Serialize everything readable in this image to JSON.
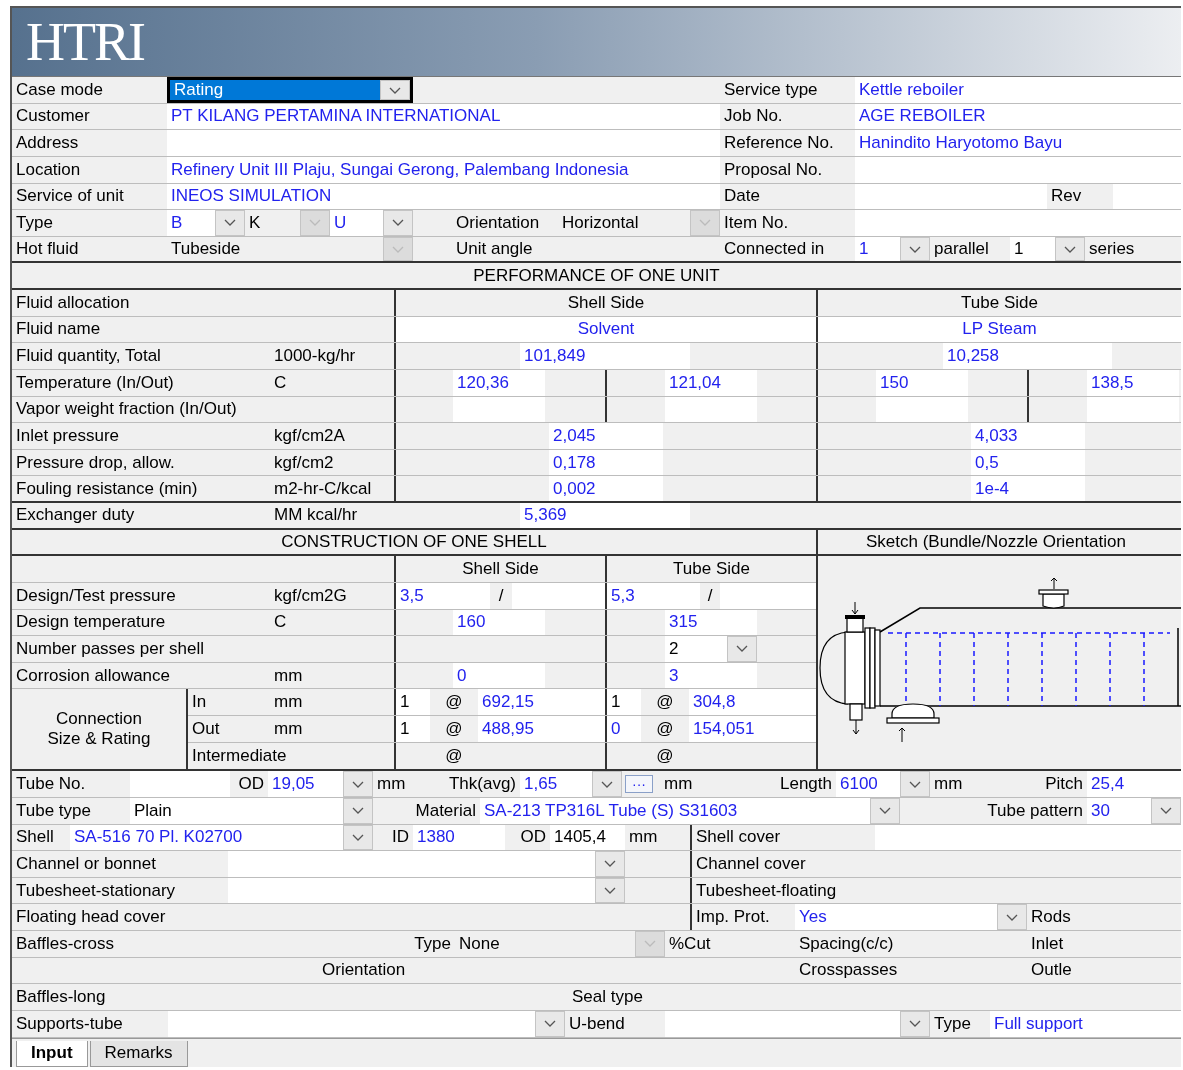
{
  "logo": "HTRI",
  "general": {
    "lines": [
      {
        "fields": [
          {
            "kind": "label",
            "text": "Case mode"
          },
          {
            "kind": "combo",
            "text": "Rating",
            "focused": true
          },
          {
            "kind": "label",
            "text": "Service type"
          },
          {
            "kind": "value",
            "text": "Kettle reboiler"
          }
        ]
      },
      {
        "fields": [
          {
            "kind": "label",
            "text": "Customer"
          },
          {
            "kind": "value",
            "text": "PT KILANG PERTAMINA INTERNATIONAL"
          },
          {
            "kind": "label",
            "text": "Job No."
          },
          {
            "kind": "value",
            "text": "AGE REBOILER"
          }
        ]
      },
      {
        "fields": [
          {
            "kind": "label",
            "text": "Address"
          },
          {
            "kind": "field"
          },
          {
            "kind": "label",
            "text": "Reference No."
          },
          {
            "kind": "value",
            "text": "Hanindito Haryotomo Bayu"
          }
        ]
      },
      {
        "fields": [
          {
            "kind": "label",
            "text": "Location"
          },
          {
            "kind": "value",
            "text": "Refinery Unit III Plaju, Sungai Gerong, Palembang Indonesia"
          },
          {
            "kind": "label",
            "text": "Proposal No."
          },
          {
            "kind": "field"
          }
        ]
      },
      {
        "fields": [
          {
            "kind": "label",
            "text": "Service of unit"
          },
          {
            "kind": "value",
            "text": "INEOS SIMULATION"
          },
          {
            "kind": "label",
            "text": "Date"
          },
          {
            "kind": "field"
          },
          {
            "kind": "label",
            "text": "Rev"
          },
          {
            "kind": "field"
          }
        ]
      },
      {
        "fields": [
          {
            "kind": "label",
            "text": "Type"
          },
          {
            "kind": "combo",
            "text": "B"
          },
          {
            "kind": "combo",
            "text": "K",
            "disabled": true
          },
          {
            "kind": "combo",
            "text": "U"
          },
          {
            "kind": "label",
            "text": "Orientation"
          },
          {
            "kind": "combo",
            "text": "Horizontal",
            "disabled": true
          },
          {
            "kind": "label",
            "text": "Item No."
          },
          {
            "kind": "field"
          }
        ]
      },
      {
        "fields": [
          {
            "kind": "label",
            "text": "Hot fluid"
          },
          {
            "kind": "combo",
            "text": "Tubeside",
            "disabled": true
          },
          {
            "kind": "label",
            "text": "Unit angle"
          },
          {
            "kind": "label",
            "text": "Connected in"
          },
          {
            "kind": "combo",
            "text": "1"
          },
          {
            "kind": "label",
            "text": "parallel"
          },
          {
            "kind": "combo",
            "text": "1",
            "default": true
          },
          {
            "kind": "label",
            "text": "series"
          }
        ]
      }
    ]
  },
  "performance": {
    "title": "PERFORMANCE OF ONE UNIT",
    "lines": [
      {
        "fields": [
          {
            "kind": "label",
            "text": "Fluid allocation"
          },
          {
            "kind": "heading",
            "text": "Shell Side"
          },
          {
            "kind": "heading",
            "text": "Tube Side"
          }
        ]
      },
      {
        "fields": [
          {
            "kind": "label",
            "text": "Fluid name"
          },
          {
            "kind": "value",
            "text": "Solvent"
          },
          {
            "kind": "value",
            "text": "LP Steam"
          }
        ]
      },
      {
        "fields": [
          {
            "kind": "label",
            "text": "Fluid quantity, Total"
          },
          {
            "kind": "label",
            "text": "1000-kg/hr"
          },
          {
            "kind": "value",
            "text": "101,849"
          },
          {
            "kind": "value",
            "text": "10,258"
          }
        ]
      },
      {
        "fields": [
          {
            "kind": "label",
            "text": "Temperature (In/Out)"
          },
          {
            "kind": "label",
            "text": "C"
          },
          {
            "kind": "value",
            "text": "120,36"
          },
          {
            "kind": "value",
            "text": "121,04"
          },
          {
            "kind": "value",
            "text": "150"
          },
          {
            "kind": "value",
            "text": "138,5"
          }
        ]
      },
      {
        "fields": [
          {
            "kind": "label",
            "text": "Vapor weight fraction (In/Out)"
          },
          {
            "kind": "field"
          },
          {
            "kind": "field"
          },
          {
            "kind": "field"
          },
          {
            "kind": "field"
          }
        ]
      },
      {
        "fields": [
          {
            "kind": "label",
            "text": "Inlet pressure"
          },
          {
            "kind": "label",
            "text": "kgf/cm2A"
          },
          {
            "kind": "value",
            "text": "2,045"
          },
          {
            "kind": "value",
            "text": "4,033"
          }
        ]
      },
      {
        "fields": [
          {
            "kind": "label",
            "text": "Pressure drop, allow."
          },
          {
            "kind": "label",
            "text": "kgf/cm2"
          },
          {
            "kind": "value",
            "text": "0,178"
          },
          {
            "kind": "value",
            "text": "0,5"
          }
        ]
      },
      {
        "fields": [
          {
            "kind": "label",
            "text": "Fouling resistance (min)"
          },
          {
            "kind": "label",
            "text": "m2-hr-C/kcal"
          },
          {
            "kind": "value",
            "text": "0,002"
          },
          {
            "kind": "value",
            "text": "1e-4"
          }
        ]
      },
      {
        "fields": [
          {
            "kind": "label",
            "text": "Exchanger duty"
          },
          {
            "kind": "label",
            "text": "MM kcal/hr"
          },
          {
            "kind": "value",
            "text": "5,369"
          }
        ]
      }
    ]
  },
  "construction": {
    "title": "CONSTRUCTION OF ONE SHELL",
    "sketch_title": "Sketch (Bundle/Nozzle Orientation",
    "lines": [
      {
        "fields": [
          {
            "kind": "heading",
            "text": "Shell Side"
          },
          {
            "kind": "heading",
            "text": "Tube Side"
          }
        ]
      },
      {
        "fields": [
          {
            "kind": "label",
            "text": "Design/Test pressure"
          },
          {
            "kind": "label",
            "text": "kgf/cm2G"
          },
          {
            "kind": "value",
            "text": "3,5"
          },
          {
            "kind": "label",
            "text": "/"
          },
          {
            "kind": "field"
          },
          {
            "kind": "value",
            "text": "5,3"
          },
          {
            "kind": "label",
            "text": "/"
          },
          {
            "kind": "field"
          }
        ]
      },
      {
        "fields": [
          {
            "kind": "label",
            "text": "Design temperature"
          },
          {
            "kind": "label",
            "text": "C"
          },
          {
            "kind": "value",
            "text": "160"
          },
          {
            "kind": "value",
            "text": "315"
          }
        ]
      },
      {
        "fields": [
          {
            "kind": "label",
            "text": "Number passes per shell"
          },
          {
            "kind": "combo",
            "text": "2",
            "default": true
          }
        ]
      },
      {
        "fields": [
          {
            "kind": "label",
            "text": "Corrosion allowance"
          },
          {
            "kind": "label",
            "text": "mm"
          },
          {
            "kind": "value",
            "text": "0"
          },
          {
            "kind": "value",
            "text": "3"
          }
        ]
      }
    ],
    "connection": {
      "label": "Connection Size & Rating",
      "lines": [
        {
          "fields": [
            {
              "kind": "label",
              "text": "In"
            },
            {
              "kind": "label",
              "text": "mm"
            },
            {
              "kind": "value",
              "text": "1",
              "default": true
            },
            {
              "kind": "label",
              "text": "@"
            },
            {
              "kind": "value",
              "text": "692,15"
            },
            {
              "kind": "value",
              "text": "1",
              "default": true
            },
            {
              "kind": "label",
              "text": "@"
            },
            {
              "kind": "value",
              "text": "304,8"
            }
          ]
        },
        {
          "fields": [
            {
              "kind": "label",
              "text": "Out"
            },
            {
              "kind": "label",
              "text": "mm"
            },
            {
              "kind": "value",
              "text": "1",
              "default": true
            },
            {
              "kind": "label",
              "text": "@"
            },
            {
              "kind": "value",
              "text": "488,95"
            },
            {
              "kind": "value",
              "text": "0"
            },
            {
              "kind": "label",
              "text": "@"
            },
            {
              "kind": "value",
              "text": "154,051"
            }
          ]
        },
        {
          "fields": [
            {
              "kind": "label",
              "text": "Intermediate"
            },
            {
              "kind": "label",
              "text": "@"
            },
            {
              "kind": "label",
              "text": "@"
            }
          ]
        }
      ]
    }
  },
  "mechanical": {
    "lines": [
      {
        "fields": [
          {
            "kind": "label",
            "text": "Tube No."
          },
          {
            "kind": "field"
          },
          {
            "kind": "label",
            "text": "OD"
          },
          {
            "kind": "combo",
            "text": "19,05"
          },
          {
            "kind": "label",
            "text": "mm"
          },
          {
            "kind": "label",
            "text": "Thk(avg)"
          },
          {
            "kind": "combo",
            "text": "1,65"
          },
          {
            "kind": "button",
            "text": "···"
          },
          {
            "kind": "label",
            "text": "mm"
          },
          {
            "kind": "label",
            "text": "Length"
          },
          {
            "kind": "combo",
            "text": "6100"
          },
          {
            "kind": "label",
            "text": "mm"
          },
          {
            "kind": "label",
            "text": "Pitch"
          },
          {
            "kind": "value",
            "text": "25,4"
          }
        ]
      },
      {
        "fields": [
          {
            "kind": "label",
            "text": "Tube type"
          },
          {
            "kind": "combo",
            "text": "Plain",
            "default": true
          },
          {
            "kind": "label",
            "text": "Material"
          },
          {
            "kind": "combo",
            "text": "SA-213 TP316L Tube (S) S31603"
          },
          {
            "kind": "label",
            "text": "Tube pattern"
          },
          {
            "kind": "combo",
            "text": "30"
          }
        ]
      },
      {
        "fields": [
          {
            "kind": "label",
            "text": "Shell"
          },
          {
            "kind": "combo",
            "text": "SA-516 70 Pl. K02700"
          },
          {
            "kind": "label",
            "text": "ID"
          },
          {
            "kind": "value",
            "text": "1380"
          },
          {
            "kind": "label",
            "text": "OD"
          },
          {
            "kind": "value",
            "text": "1405,4",
            "default": true
          },
          {
            "kind": "label",
            "text": "mm"
          },
          {
            "kind": "label",
            "text": "Shell cover"
          },
          {
            "kind": "field"
          }
        ]
      },
      {
        "fields": [
          {
            "kind": "label",
            "text": "Channel or bonnet"
          },
          {
            "kind": "combo"
          },
          {
            "kind": "label",
            "text": "Channel cover"
          }
        ]
      },
      {
        "fields": [
          {
            "kind": "label",
            "text": "Tubesheet-stationary"
          },
          {
            "kind": "combo"
          },
          {
            "kind": "label",
            "text": "Tubesheet-floating"
          }
        ]
      },
      {
        "fields": [
          {
            "kind": "label",
            "text": "Floating head cover"
          },
          {
            "kind": "label",
            "text": "Imp. Prot."
          },
          {
            "kind": "combo",
            "text": "Yes"
          },
          {
            "kind": "label",
            "text": "Rods"
          }
        ]
      },
      {
        "fields": [
          {
            "kind": "label",
            "text": "Baffles-cross"
          },
          {
            "kind": "label",
            "text": "Type"
          },
          {
            "kind": "combo",
            "text": "None",
            "disabled": true
          },
          {
            "kind": "label",
            "text": "%Cut"
          },
          {
            "kind": "label",
            "text": "Spacing(c/c)"
          },
          {
            "kind": "label",
            "text": "Inlet"
          }
        ]
      },
      {
        "fields": [
          {
            "kind": "label",
            "text": "Orientation"
          },
          {
            "kind": "label",
            "text": "Crosspasses"
          },
          {
            "kind": "label",
            "text": "Outle"
          }
        ]
      },
      {
        "fields": [
          {
            "kind": "label",
            "text": "Baffles-long"
          },
          {
            "kind": "label",
            "text": "Seal type"
          }
        ]
      },
      {
        "fields": [
          {
            "kind": "label",
            "text": "Supports-tube"
          },
          {
            "kind": "combo"
          },
          {
            "kind": "label",
            "text": "U-bend"
          },
          {
            "kind": "combo"
          },
          {
            "kind": "label",
            "text": "Type"
          },
          {
            "kind": "value",
            "text": "Full support"
          }
        ]
      }
    ]
  },
  "tabs": [
    {
      "label": "Input",
      "selected": true
    },
    {
      "label": "Remarks",
      "selected": false
    }
  ]
}
